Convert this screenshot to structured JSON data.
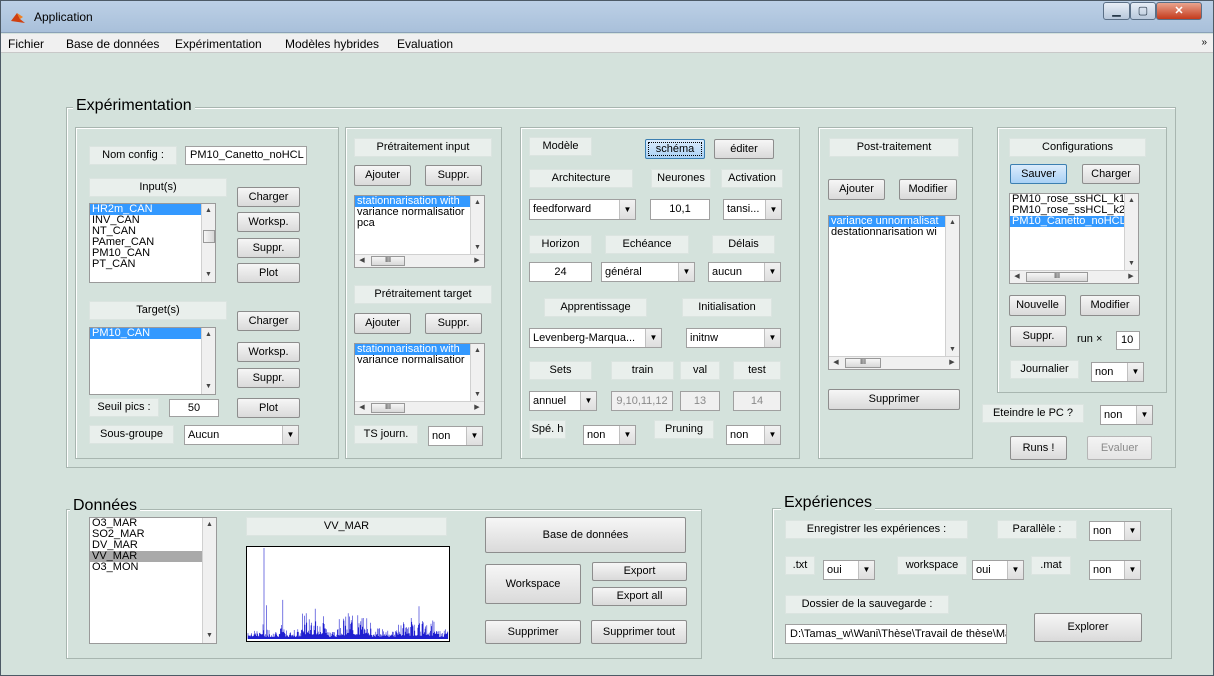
{
  "window": {
    "title": "Application"
  },
  "menu": [
    "Fichier",
    "Base de données",
    "Expérimentation",
    "Modèles hybrides",
    "Evaluation"
  ],
  "experimentation": {
    "title": "Expérimentation",
    "config": {
      "nom_label": "Nom config :",
      "nom_value": "PM10_Canetto_noHCL",
      "inputs_label": "Input(s)",
      "inputs": [
        "HR2m_CAN",
        "INV_CAN",
        "NT_CAN",
        "PAmer_CAN",
        "PM10_CAN",
        "PT_CAN"
      ],
      "inputs_selected": 0,
      "charger": "Charger",
      "worksp": "Worksp.",
      "suppr": "Suppr.",
      "plot": "Plot",
      "target_label": "Target(s)",
      "targets": [
        "PM10_CAN"
      ],
      "seuil_label": "Seuil pics :",
      "seuil_value": "50",
      "sousgroupe_label": "Sous-groupe",
      "sousgroupe_value": "Aucun"
    },
    "pretraitement": {
      "input_label": "Prétraitement input",
      "ajouter": "Ajouter",
      "suppr": "Suppr.",
      "input_list": [
        "stationnarisation with",
        "variance normalisatior",
        "pca"
      ],
      "target_label": "Prétraitement target",
      "target_list": [
        "stationnarisation with",
        "variance normalisatior"
      ],
      "ts_label": "TS journ.",
      "ts_value": "non"
    },
    "modele": {
      "label": "Modèle",
      "schema": "schéma",
      "editer": "éditer",
      "architecture_label": "Architecture",
      "neurones_label": "Neurones",
      "activation_label": "Activation",
      "architecture_value": "feedforward",
      "neurones_value": "10,1",
      "activation_value": "tansi...",
      "horizon_label": "Horizon",
      "echeance_label": "Echéance",
      "delais_label": "Délais",
      "horizon_value": "24",
      "echeance_value": "général",
      "delais_value": "aucun",
      "apprentissage_label": "Apprentissage",
      "initialisation_label": "Initialisation",
      "apprentissage_value": "Levenberg-Marqua...",
      "initialisation_value": "initnw",
      "sets_label": "Sets",
      "train_label": "train",
      "val_label": "val",
      "test_label": "test",
      "sets_value": "annuel",
      "train_value": "9,10,11,12",
      "val_value": "13",
      "test_value": "14",
      "speh_label": "Spé. h",
      "speh_value": "non",
      "pruning_label": "Pruning",
      "pruning_value": "non"
    },
    "post": {
      "label": "Post-traitement",
      "ajouter": "Ajouter",
      "modifier": "Modifier",
      "list": [
        "variance unnormalisat",
        "destationnarisation wi"
      ],
      "supprimer": "Supprimer"
    },
    "configurations": {
      "label": "Configurations",
      "sauver": "Sauver",
      "charger": "Charger",
      "list": [
        "PM10_rose_ssHCL_k1",
        "PM10_rose_ssHCL_k2",
        "PM10_Canetto_noHCL"
      ],
      "nouvelle": "Nouvelle",
      "modifier": "Modifier",
      "suppr": "Suppr.",
      "run_label": "run ×",
      "run_value": "10",
      "journalier_label": "Journalier",
      "journalier_value": "non",
      "eteindre_label": "Eteindre le PC ?",
      "eteindre_value": "non",
      "runs": "Runs !",
      "evaluer": "Evaluer"
    }
  },
  "donnees": {
    "title": "Données",
    "list": [
      "O3_MAR",
      "SO2_MAR",
      "DV_MAR",
      "VV_MAR",
      "O3_MON"
    ],
    "selected": 3,
    "plot_title": "VV_MAR",
    "base": "Base de données",
    "workspace": "Workspace",
    "export": "Export",
    "export_all": "Export all",
    "supprimer": "Supprimer",
    "supprimer_tout": "Supprimer tout"
  },
  "experiences": {
    "title": "Expériences",
    "enregistrer_label": "Enregistrer les expériences :",
    "parallele_label": "Parallèle :",
    "parallele_value": "non",
    "txt_label": ".txt",
    "txt_value": "oui",
    "workspace_label": "workspace",
    "workspace_value": "oui",
    "mat_label": ".mat",
    "mat_value": "non",
    "dossier_label": "Dossier de la sauvegarde :",
    "dossier_value": "D:\\Tamas_w\\Wani\\Thèse\\Travail de thèse\\Ma",
    "explorer": "Explorer"
  },
  "colors": {
    "panel_bg": "#d4e2dc",
    "selection": "#3399ff",
    "plot_line": "#1f1fd0"
  }
}
